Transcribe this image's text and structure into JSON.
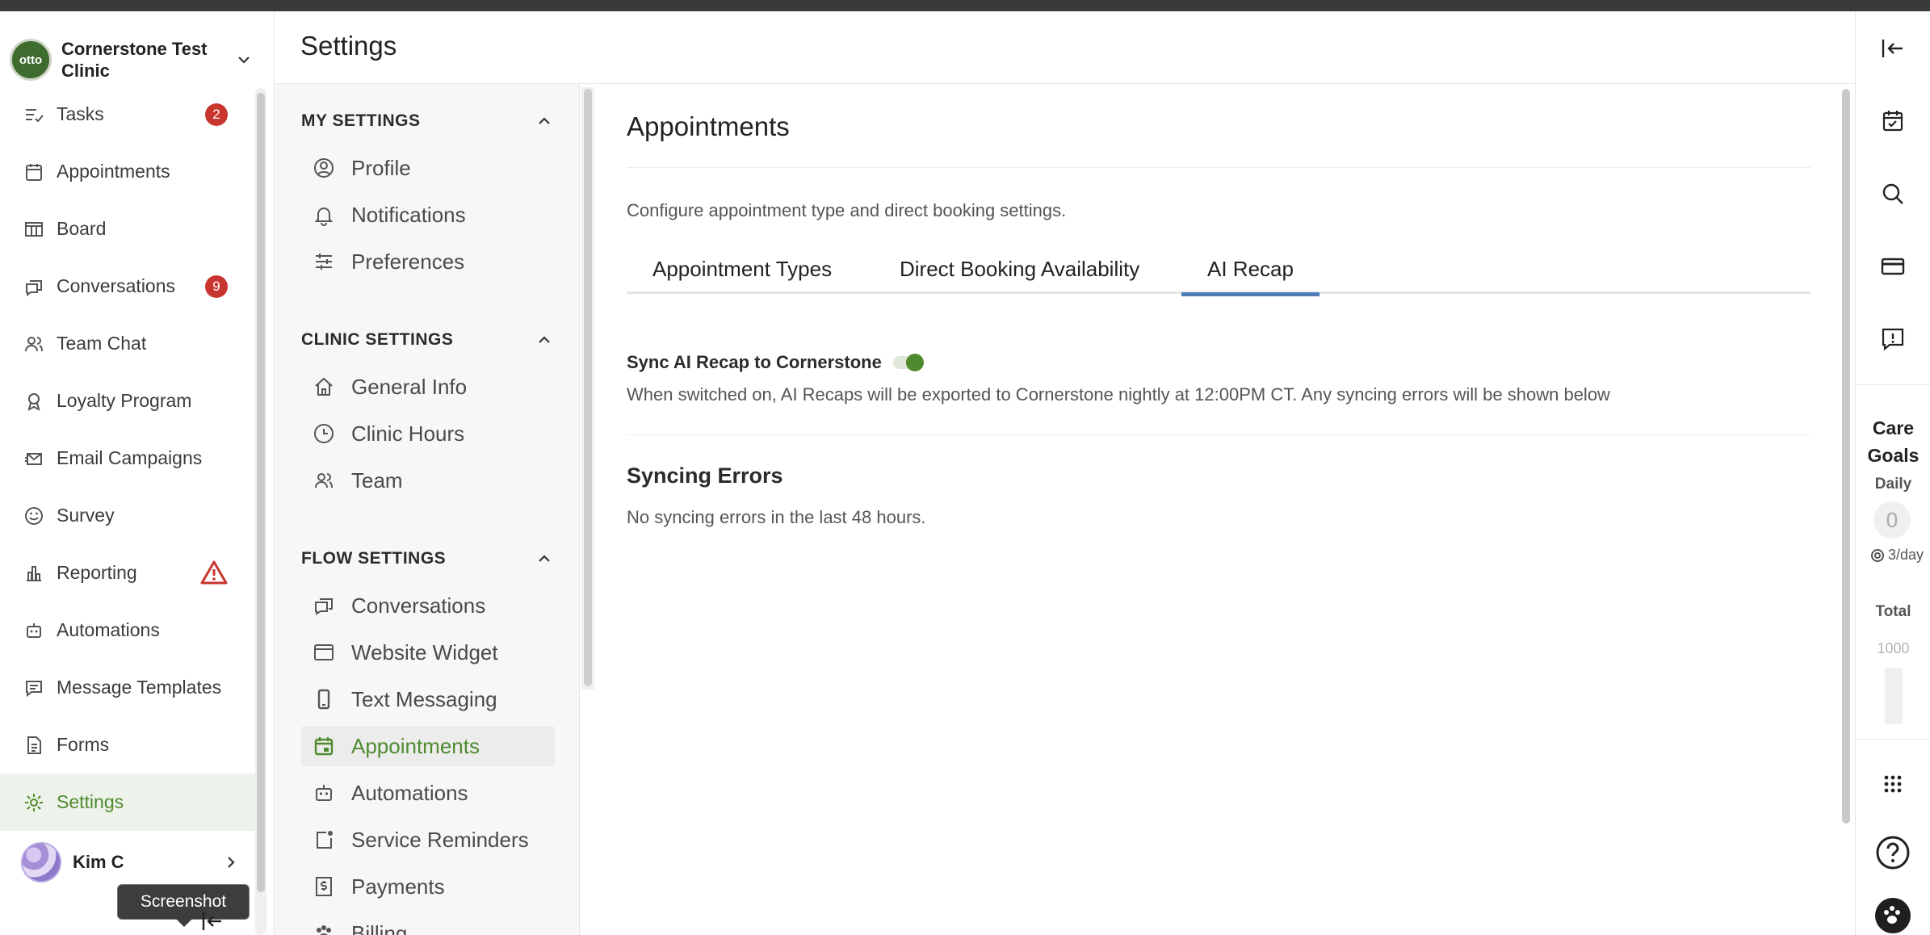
{
  "clinic": {
    "name": "Cornerstone Test Clinic",
    "logo_text": "otto"
  },
  "nav": {
    "items": [
      {
        "label": "Tasks",
        "icon": "tasks-icon",
        "badge": "2"
      },
      {
        "label": "Appointments",
        "icon": "calendar-icon"
      },
      {
        "label": "Board",
        "icon": "board-icon"
      },
      {
        "label": "Conversations",
        "icon": "chat-icon",
        "badge": "9"
      },
      {
        "label": "Team Chat",
        "icon": "team-icon"
      },
      {
        "label": "Loyalty Program",
        "icon": "award-icon"
      },
      {
        "label": "Email Campaigns",
        "icon": "email-icon"
      },
      {
        "label": "Survey",
        "icon": "smile-icon"
      },
      {
        "label": "Reporting",
        "icon": "bar-chart-icon",
        "warning": true
      },
      {
        "label": "Automations",
        "icon": "robot-icon"
      },
      {
        "label": "Message Templates",
        "icon": "message-template-icon"
      },
      {
        "label": "Forms",
        "icon": "document-icon"
      },
      {
        "label": "Settings",
        "icon": "gear-icon",
        "active": true
      }
    ]
  },
  "user": {
    "name": "Kim C"
  },
  "tooltip": {
    "text": "Screenshot"
  },
  "header": {
    "title": "Settings"
  },
  "settings_nav": {
    "my_settings": {
      "title": "MY SETTINGS",
      "items": [
        "Profile",
        "Notifications",
        "Preferences"
      ]
    },
    "clinic_settings": {
      "title": "CLINIC SETTINGS",
      "items": [
        "General Info",
        "Clinic Hours",
        "Team"
      ]
    },
    "flow_settings": {
      "title": "FLOW SETTINGS",
      "items": [
        "Conversations",
        "Website Widget",
        "Text Messaging",
        "Appointments",
        "Automations",
        "Service Reminders",
        "Payments",
        "Billing"
      ]
    },
    "active_item": "Appointments"
  },
  "main": {
    "title": "Appointments",
    "description": "Configure appointment type and direct booking settings.",
    "tabs": [
      "Appointment Types",
      "Direct Booking Availability",
      "AI Recap"
    ],
    "active_tab": "AI Recap",
    "sync": {
      "label": "Sync AI Recap to Cornerstone",
      "enabled": true,
      "help": "When switched on, AI Recaps will be exported to Cornerstone nightly at 12:00PM CT. Any syncing errors will be shown below"
    },
    "errors": {
      "title": "Syncing Errors",
      "text": "No syncing errors in the last 48 hours."
    }
  },
  "care_goals": {
    "title": "Care Goals",
    "daily_label": "Daily",
    "daily_value": "0",
    "daily_rate": "3/day",
    "total_label": "Total",
    "total_goal": "1000"
  },
  "colors": {
    "accent_green": "#4f8b2e",
    "badge_red": "#c8362f",
    "tab_blue": "#4f7db9"
  }
}
